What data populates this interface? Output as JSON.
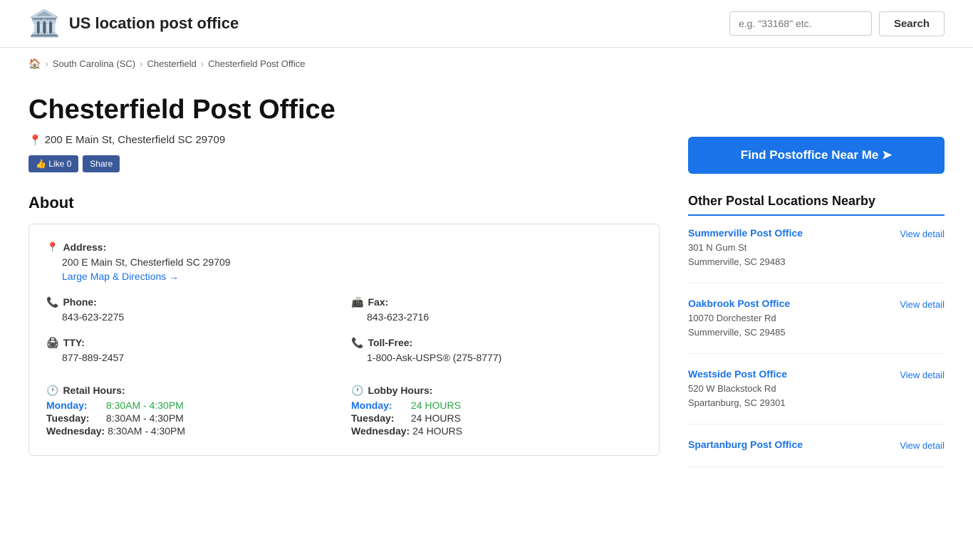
{
  "site": {
    "title": "US location post office",
    "logo": "🏛️",
    "search_placeholder": "e.g. \"33168\" etc.",
    "search_label": "Search"
  },
  "breadcrumb": {
    "home_icon": "🏠",
    "items": [
      {
        "label": "South Carolina (SC)",
        "href": "#"
      },
      {
        "label": "Chesterfield",
        "href": "#"
      },
      {
        "label": "Chesterfield Post Office",
        "href": "#"
      }
    ]
  },
  "main": {
    "page_title": "Chesterfield Post Office",
    "address_pin": "📍",
    "address": "200 E Main St, Chesterfield SC 29709",
    "fb_like": "👍 Like 0",
    "fb_share": "Share",
    "about_title": "About",
    "address_label": "Address:",
    "address_value": "200 E Main St, Chesterfield SC 29709",
    "map_link": "Large Map & Directions →",
    "phone_label": "Phone:",
    "phone_value": "843-623-2275",
    "fax_label": "Fax:",
    "fax_value": "843-623-2716",
    "tty_label": "TTY:",
    "tty_value": "877-889-2457",
    "tollfree_label": "Toll-Free:",
    "tollfree_value": "1-800-Ask-USPS® (275-8777)",
    "retail_hours_label": "Retail Hours:",
    "lobby_hours_label": "Lobby Hours:",
    "hours": {
      "retail": [
        {
          "day": "Monday:",
          "time": "8:30AM - 4:30PM",
          "highlight": true
        },
        {
          "day": "Tuesday:",
          "time": "8:30AM - 4:30PM",
          "highlight": false
        },
        {
          "day": "Wednesday:",
          "time": "8:30AM - 4:30PM",
          "highlight": false
        }
      ],
      "lobby": [
        {
          "day": "Monday:",
          "time": "24 HOURS",
          "highlight": true
        },
        {
          "day": "Tuesday:",
          "time": "24 HOURS",
          "highlight": false
        },
        {
          "day": "Wednesday:",
          "time": "24 HOURS",
          "highlight": false
        }
      ]
    }
  },
  "sidebar": {
    "find_btn": "Find Postoffice Near Me ➤",
    "nearby_title": "Other Postal Locations Nearby",
    "nearby_items": [
      {
        "name": "Summerville Post Office",
        "address_line1": "301 N Gum St",
        "address_line2": "Summerville, SC 29483",
        "view_detail": "View detail"
      },
      {
        "name": "Oakbrook Post Office",
        "address_line1": "10070 Dorchester Rd",
        "address_line2": "Summerville, SC 29485",
        "view_detail": "View detail"
      },
      {
        "name": "Westside Post Office",
        "address_line1": "520 W Blackstock Rd",
        "address_line2": "Spartanburg, SC 29301",
        "view_detail": "View detail"
      },
      {
        "name": "Spartanburg Post Office",
        "address_line1": "",
        "address_line2": "",
        "view_detail": "View detail"
      }
    ]
  },
  "icons": {
    "pin": "📍",
    "phone": "📞",
    "fax": "📠",
    "tty": "🖨",
    "clock": "🕐",
    "navigation": "➤"
  }
}
